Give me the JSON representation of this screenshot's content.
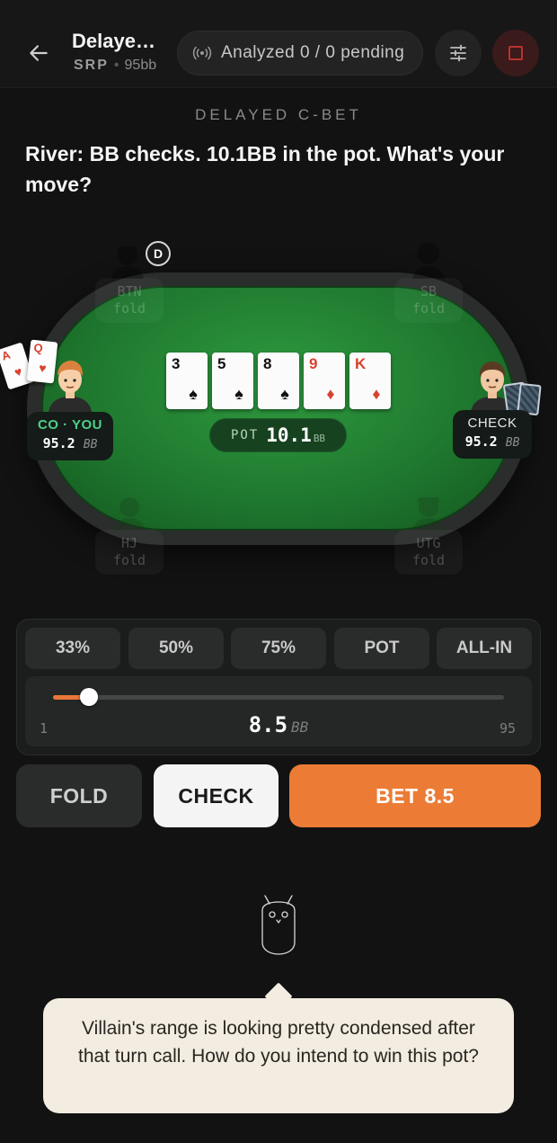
{
  "header": {
    "title": "Delaye…",
    "subtitle_tag": "SRP",
    "subtitle_stack": "95bb",
    "analyzed": "Analyzed 0 / 0 pending",
    "icons": {
      "back": "arrow-left-icon",
      "signal": "broadcast-icon",
      "settings": "sliders-icon",
      "stop": "stop-icon"
    }
  },
  "prompt": {
    "scenario": "DELAYED C-BET",
    "question": "River: BB checks. 10.1BB in the pot. What's your move?"
  },
  "table": {
    "dealer": "D",
    "board": [
      {
        "rank": "3",
        "suit": "♠",
        "color": "black"
      },
      {
        "rank": "5",
        "suit": "♠",
        "color": "black"
      },
      {
        "rank": "8",
        "suit": "♠",
        "color": "black"
      },
      {
        "rank": "9",
        "suit": "♦",
        "color": "red"
      },
      {
        "rank": "K",
        "suit": "♦",
        "color": "red"
      }
    ],
    "pot": {
      "label": "POT",
      "value": "10.1",
      "unit": "BB"
    },
    "hero": {
      "position": "CO · YOU",
      "stack": "95.2",
      "unit": "BB",
      "cards": [
        {
          "rank": "A",
          "suit": "♥"
        },
        {
          "rank": "Q",
          "suit": "♥"
        }
      ]
    },
    "villain": {
      "action": "CHECK",
      "stack": "95.2",
      "unit": "BB"
    },
    "folded_seats": [
      {
        "pos": "BTN",
        "status": "fold"
      },
      {
        "pos": "SB",
        "status": "fold"
      },
      {
        "pos": "HJ",
        "status": "fold"
      },
      {
        "pos": "UTG",
        "status": "fold"
      }
    ]
  },
  "bet_controls": {
    "presets": [
      "33%",
      "50%",
      "75%",
      "POT",
      "ALL-IN"
    ],
    "slider": {
      "min": "1",
      "max": "95",
      "value": "8.5",
      "unit": "BB",
      "fraction": 0.08
    }
  },
  "actions": {
    "fold": "FOLD",
    "check": "CHECK",
    "bet": "BET 8.5"
  },
  "coach": {
    "message": "Villain's range is looking pretty condensed after that turn call. How do you intend to win this pot?"
  },
  "colors": {
    "accent": "#ec7c35",
    "felt": "#1f7a2f",
    "hero": "#4fd08a",
    "coach_bg": "#f3ece1"
  }
}
